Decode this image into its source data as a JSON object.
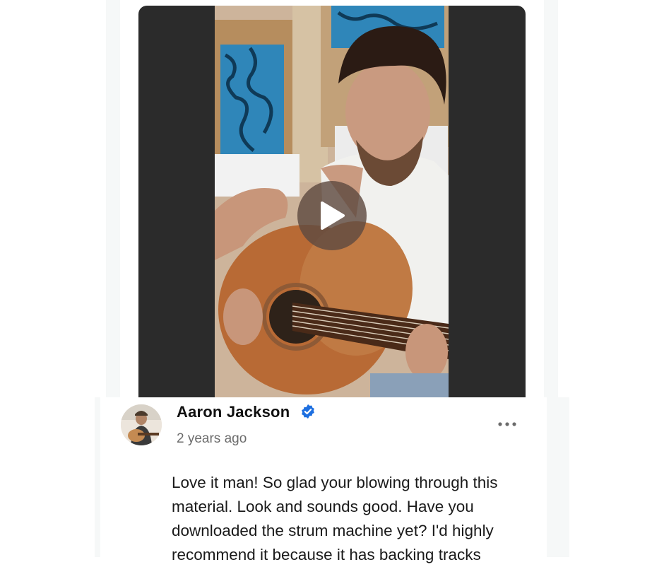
{
  "video": {
    "play_icon": "play-icon",
    "overlay_color": "#5f4b41"
  },
  "comment": {
    "author": "Aaron Jackson",
    "verified_icon": "verified-badge-icon",
    "verified_color": "#1d6fe0",
    "timestamp": "2 years ago",
    "more_icon": "more-horizontal-icon",
    "body": "Love it man! So glad your blowing through this material. Look and sounds good. Have you downloaded the strum machine yet? I'd highly recommend it because it has backing tracks"
  }
}
